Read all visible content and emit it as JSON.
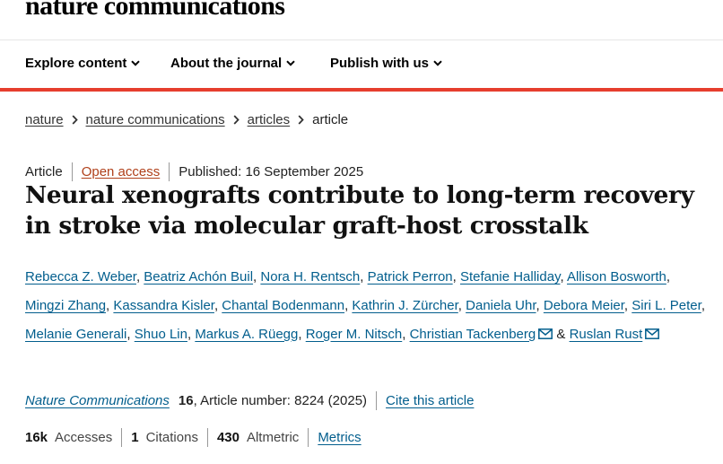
{
  "brand": {
    "logo_text": "nature communications"
  },
  "nav": {
    "items": [
      {
        "label": "Explore content"
      },
      {
        "label": "About the journal"
      },
      {
        "label": "Publish with us"
      }
    ]
  },
  "breadcrumb": {
    "items": [
      "nature",
      "nature communications",
      "articles"
    ],
    "current": "article"
  },
  "article": {
    "type": "Article",
    "access": "Open access",
    "published": "Published: 16 September 2025",
    "title": "Neural xenografts contribute to long-term recovery in stroke via molecular graft-host crosstalk",
    "authors": [
      "Rebecca Z. Weber",
      "Beatriz Achón Buil",
      "Nora H. Rentsch",
      "Patrick Perron",
      "Stefanie Halliday",
      "Allison Bosworth",
      "Mingzi Zhang",
      "Kassandra Kisler",
      "Chantal Bodenmann",
      "Kathrin J. Zürcher",
      "Daniela Uhr",
      "Debora Meier",
      "Siri L. Peter",
      "Melanie Generali",
      "Shuo Lin",
      "Markus A. Rüegg",
      "Roger M. Nitsch",
      "Christian Tackenberg",
      "Ruslan Rust"
    ],
    "author_separator": ", ",
    "last_author_joiner": " & ",
    "journal": "Nature Communications",
    "volume": "16",
    "article_number": ", Article number: 8224 (2025)",
    "cite_label": "Cite this article"
  },
  "metrics": {
    "accesses_value": "16k",
    "accesses_label": "Accesses",
    "citations_value": "1",
    "citations_label": "Citations",
    "altmetric_value": "430",
    "altmetric_label": "Altmetric",
    "metrics_link": "Metrics"
  },
  "colors": {
    "accent_red": "#e63e2e",
    "link_blue": "#025e8d",
    "open_access": "#b0401a"
  },
  "icons": {
    "nav_chevron": "chevron-down-icon",
    "breadcrumb_separator": "chevron-right-icon",
    "corresponding_author": "mail-icon"
  }
}
